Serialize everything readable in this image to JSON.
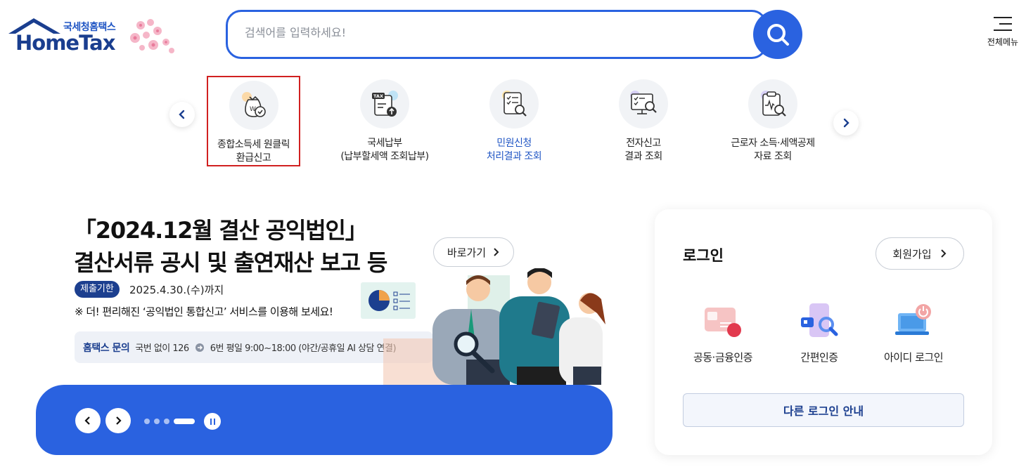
{
  "header": {
    "logo_sub": "국세청홈택스",
    "logo_main": "HomeTax",
    "search": {
      "placeholder": "검색어를 입력하세요!",
      "value": ""
    },
    "menu_label": "전체메뉴"
  },
  "quick_menu": {
    "items": [
      {
        "line1": "종합소득세 원클릭",
        "line2": "환급신고",
        "icon": "money-bag-check-icon",
        "selected": true
      },
      {
        "line1": "국세납부",
        "line2": "(납부할세액 조회납부)",
        "icon": "tax-document-upload-icon"
      },
      {
        "line1": "민원신청",
        "line2": "처리결과 조회",
        "icon": "document-search-icon",
        "highlight": true
      },
      {
        "line1": "전자신고",
        "line2": "결과 조회",
        "icon": "monitor-search-icon"
      },
      {
        "line1": "근로자 소득·세액공제",
        "line2": "자료 조회",
        "icon": "clipboard-search-icon"
      }
    ]
  },
  "banner": {
    "title_line1": "「2024.12월 결산 공익법인」",
    "title_line2": "결산서류 공시 및 출연재산 보고 등",
    "go_label": "바로가기",
    "deadline_badge": "제출기한",
    "deadline_date": "2025.4.30.(수)까지",
    "notice": "※ 더! 편리해진 ‘공익법인 통합신고’ 서비스를 이용해 보세요!",
    "contact_title": "홈택스 문의",
    "contact_text_1": "국번 없이 126",
    "contact_text_2": "6번 평일 9:00~18:00 (야간/공휴일 AI 상담 연결)",
    "slides_total": 4,
    "slide_active": 4
  },
  "login": {
    "title": "로그인",
    "signup_label": "회원가입",
    "options": [
      {
        "label": "공동·금융인증",
        "icon": "certificate-card-icon"
      },
      {
        "label": "간편인증",
        "icon": "phone-auth-icon"
      },
      {
        "label": "아이디 로그인",
        "icon": "laptop-power-icon"
      }
    ],
    "other_login_label": "다른 로그인 안내"
  },
  "colors": {
    "primary": "#2a62e0",
    "navy": "#1c3f8f",
    "selected_border": "#d12020"
  }
}
